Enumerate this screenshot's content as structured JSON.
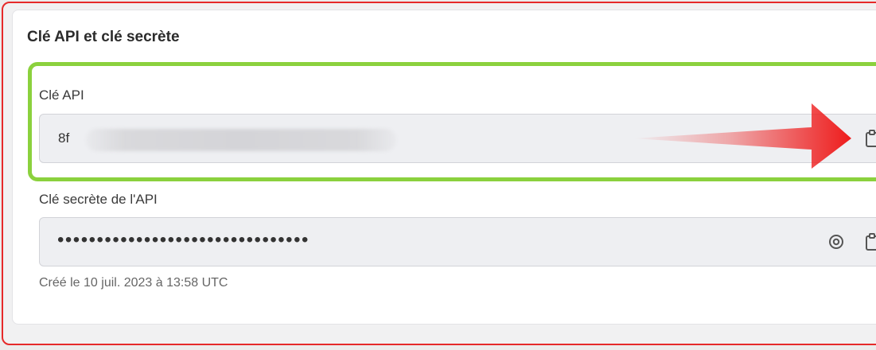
{
  "card": {
    "title": "Clé API et clé secrète"
  },
  "api_key": {
    "label": "Clé API",
    "value_prefix": "8f",
    "value_obscured": true
  },
  "secret_key": {
    "label": "Clé secrète de l'API",
    "masked_value": "••••••••••••••••••••••••••••••••"
  },
  "created": {
    "text": "Créé le 10 juil. 2023 à 13:58 UTC"
  },
  "icons": {
    "copy": "clipboard-icon",
    "reveal": "eye-icon",
    "annotation": "red-arrow"
  },
  "colors": {
    "outer_border": "#e62a2a",
    "highlight_border": "#8bd13d",
    "arrow": "#ee1c1c",
    "field_background": "#eeeff2"
  }
}
